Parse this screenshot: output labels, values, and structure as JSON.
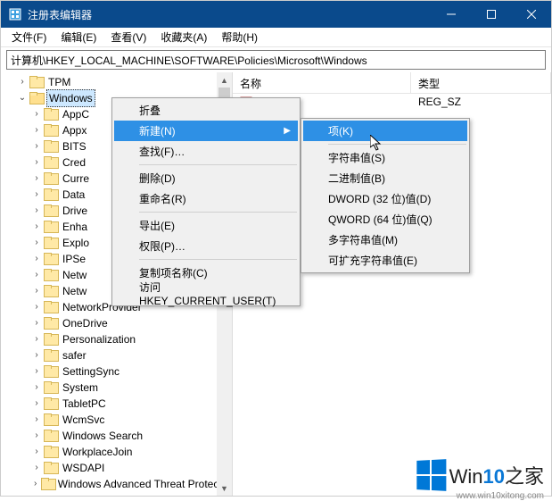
{
  "titlebar": {
    "title": "注册表编辑器"
  },
  "menubar": {
    "file": "文件(F)",
    "edit": "编辑(E)",
    "view": "查看(V)",
    "fav": "收藏夹(A)",
    "help": "帮助(H)"
  },
  "address": {
    "path": "计算机\\HKEY_LOCAL_MACHINE\\SOFTWARE\\Policies\\Microsoft\\Windows"
  },
  "columns": {
    "name": "名称",
    "type": "类型"
  },
  "right_values": {
    "default_type": "REG_SZ"
  },
  "tree": {
    "tpm": "TPM",
    "windows": "Windows",
    "items": [
      "AppC",
      "Appx",
      "BITS",
      "Cred",
      "Curre",
      "Data",
      "Drive",
      "Enha",
      "Explo",
      "IPSe",
      "Netw1",
      "Netw2",
      "NetworkProvider",
      "OneDrive",
      "Personalization",
      "safer",
      "SettingSync",
      "System",
      "TabletPC",
      "WcmSvc",
      "Windows Search",
      "WorkplaceJoin",
      "WSDAPI",
      "Windows Advanced Threat Protectio"
    ],
    "display": {
      "AppC": "AppC",
      "Appx": "Appx",
      "BITS": "BITS",
      "Cred": "Cred",
      "Curre": "Curre",
      "Data": "Data",
      "Drive": "Drive",
      "Enha": "Enha",
      "Explo": "Explo",
      "IPSe": "IPSe",
      "Netw1": "Netw",
      "Netw2": "Netw",
      "NetworkProvider": "NetworkProvider",
      "OneDrive": "OneDrive",
      "Personalization": "Personalization",
      "safer": "safer",
      "SettingSync": "SettingSync",
      "System": "System",
      "TabletPC": "TabletPC",
      "WcmSvc": "WcmSvc",
      "Windows Search": "Windows Search",
      "WorkplaceJoin": "WorkplaceJoin",
      "WSDAPI": "WSDAPI",
      "Windows Advanced Threat Protectio": "Windows Advanced Threat Protectio"
    }
  },
  "ctx1": {
    "collapse": "折叠",
    "new": "新建(N)",
    "find": "查找(F)…",
    "delete": "删除(D)",
    "rename": "重命名(R)",
    "export": "导出(E)",
    "perm": "权限(P)…",
    "copykey": "复制项名称(C)",
    "goto": "访问 HKEY_CURRENT_USER(T)"
  },
  "ctx2": {
    "key": "项(K)",
    "string": "字符串值(S)",
    "binary": "二进制值(B)",
    "dword": "DWORD (32 位)值(D)",
    "qword": "QWORD (64 位)值(Q)",
    "multi": "多字符串值(M)",
    "expand": "可扩充字符串值(E)"
  },
  "watermark": {
    "brand_a": "Win",
    "brand_b": "10",
    "brand_c": "之家",
    "url": "www.win10xitong.com"
  }
}
